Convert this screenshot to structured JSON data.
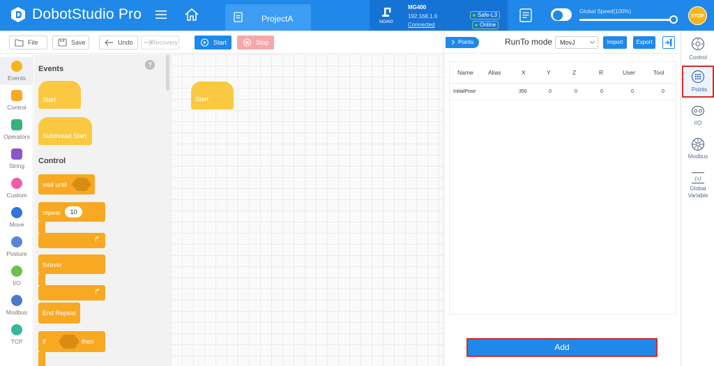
{
  "app": {
    "title": "DobotStudio Pro"
  },
  "project_tab": {
    "label": "ProjectA"
  },
  "robot": {
    "model": "MG400",
    "model_small": "MG400",
    "ip": "192.168.1.6",
    "connection": "Connected",
    "safety": "Safe-L3",
    "status": "Online"
  },
  "speed": {
    "label": "Global Speed(100%)",
    "percent": 100
  },
  "stop_button": {
    "label": "STOP"
  },
  "toolbar": {
    "file": "File",
    "save": "Save",
    "undo": "Undo",
    "recovery": "Recovery",
    "start": "Start",
    "stop": "Stop"
  },
  "categories": [
    {
      "label": "Events",
      "color": "#f6b51a"
    },
    {
      "label": "Control",
      "color": "#f8a821"
    },
    {
      "label": "Operators",
      "color": "#34b37c"
    },
    {
      "label": "String",
      "color": "#8a56c9"
    },
    {
      "label": "Custom",
      "color": "#ef5da8"
    },
    {
      "label": "Move",
      "color": "#2f74d6"
    },
    {
      "label": "Posture",
      "color": "#5a86d8"
    },
    {
      "label": "I/O",
      "color": "#6cc04a"
    },
    {
      "label": "Modbus",
      "color": "#4a79c9"
    },
    {
      "label": "TCP",
      "color": "#38b59a"
    }
  ],
  "palette": {
    "events_title": "Events",
    "control_title": "Control",
    "blocks": {
      "start": "Start",
      "subthread_start": "Subthread Start",
      "wait_until": "wait until",
      "repeat": "repeat",
      "repeat_count": "10",
      "forever": "forever",
      "end_repeat": "End Repeat",
      "if": "if",
      "then": "then"
    }
  },
  "workspace": {
    "start_block": "Start"
  },
  "points_panel": {
    "tag": "Points",
    "runto_label": "RunTo mode",
    "runto_value": "MovJ",
    "import": "Import",
    "export": "Export",
    "columns": [
      "Name",
      "Alias",
      "X",
      "Y",
      "Z",
      "R",
      "User",
      "Tool"
    ],
    "rows": [
      [
        "InitialPose",
        "",
        "350",
        "0",
        "0",
        "0",
        "0",
        "0"
      ]
    ],
    "add_button": "Add"
  },
  "right_tabs": [
    {
      "label": "Control",
      "active": false
    },
    {
      "label": "Points",
      "active": true
    },
    {
      "label": "I/O",
      "active": false
    },
    {
      "label": "Modbus",
      "active": false
    },
    {
      "label": "Global Variable",
      "active": false
    }
  ],
  "colors": {
    "primary": "#1f88e8",
    "highlight": "#d32b2b",
    "block_orange": "#f8a821",
    "block_yellow": "#fbc941"
  }
}
